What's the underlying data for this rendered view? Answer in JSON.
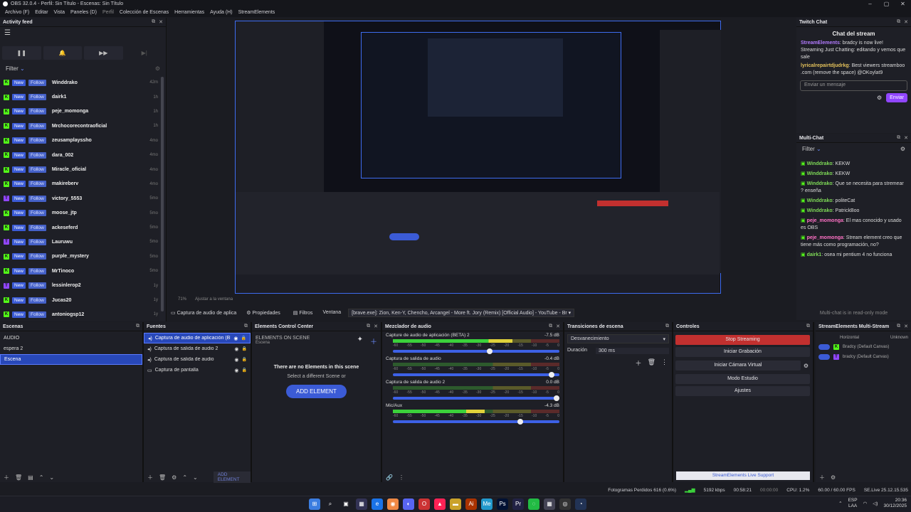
{
  "window": {
    "title": "OBS 32.0.4 - Perfil: Sin Título - Escenas: Sin Título",
    "controls": [
      "–",
      "▢",
      "✕"
    ]
  },
  "menu": [
    "Archivo (F)",
    "Editar",
    "Vista",
    "Paneles (D)",
    "Perfil",
    "Colección de Escenas",
    "Herramientas",
    "Ayuda (H)",
    "StreamElements"
  ],
  "activity": {
    "title": "Activity feed",
    "controls": [
      "❚❚",
      "🔔",
      "▶▶",
      "▶|"
    ],
    "filter": "Filter",
    "items": [
      {
        "platform": "kick",
        "name": "Winddrako",
        "time": "42m"
      },
      {
        "platform": "kick",
        "name": "dairk1",
        "time": "1h"
      },
      {
        "platform": "kick",
        "name": "peje_momonga",
        "time": "1h"
      },
      {
        "platform": "kick",
        "name": "Mrchocorecontraoficial",
        "time": "1h"
      },
      {
        "platform": "kick",
        "name": "zeusamplayssho",
        "time": "4mo"
      },
      {
        "platform": "kick",
        "name": "dara_002",
        "time": "4mo"
      },
      {
        "platform": "kick",
        "name": "Miracle_oficial",
        "time": "4mo"
      },
      {
        "platform": "kick",
        "name": "makireberv",
        "time": "4mo"
      },
      {
        "platform": "twitch",
        "name": "victory_5553",
        "time": "5mo"
      },
      {
        "platform": "kick",
        "name": "moose_jtp",
        "time": "5mo"
      },
      {
        "platform": "kick",
        "name": "ackeseferd",
        "time": "5mo"
      },
      {
        "platform": "twitch",
        "name": "Lauruwu",
        "time": "5mo"
      },
      {
        "platform": "kick",
        "name": "purple_mystery",
        "time": "5mo"
      },
      {
        "platform": "kick",
        "name": "MrTinoco",
        "time": "5mo"
      },
      {
        "platform": "twitch",
        "name": "lessinlerop2",
        "time": "1y"
      },
      {
        "platform": "kick",
        "name": "Jucas20",
        "time": "1y"
      },
      {
        "platform": "kick",
        "name": "antoniogsp12",
        "time": "1y"
      }
    ],
    "badge_new": "New",
    "badge_follow": "Follow"
  },
  "preview_bar": {
    "zoom": "71%",
    "fit": "Ajustar a la ventana"
  },
  "twitch": {
    "title": "Twitch Chat",
    "header": "Chat del stream",
    "messages": [
      {
        "user": "StreamElements",
        "text": ": bradcy is now live! Streaming Just Chatting: editando y vemos que sale"
      },
      {
        "user": "lyricalrepairtdjudrkg",
        "text": ": Best viewers streamboo .com (remove the space) @OKoylat9"
      }
    ],
    "input_placeholder": "Enviar un mensaje",
    "send": "Enviar"
  },
  "multichat": {
    "title": "Multi-Chat",
    "filter": "Filter",
    "messages": [
      {
        "user": "Winddrako",
        "text": ": KEKW",
        "c": "grn"
      },
      {
        "user": "Winddrako",
        "text": ": KEKW",
        "c": "grn"
      },
      {
        "user": "Winddrako",
        "text": ": Que se necesita para stremear ? enseña",
        "c": "grn"
      },
      {
        "user": "Winddrako",
        "text": ": politeCat",
        "c": "grn"
      },
      {
        "user": "Winddrako",
        "text": ": PatrickBoo",
        "c": "grn"
      },
      {
        "user": "peje_momonga",
        "text": ": El mas conocido y usado es OBS",
        "c": "pnk"
      },
      {
        "user": "peje_momonga",
        "text": ": Stream element creo que tiene más como programación, no?",
        "c": "pnk"
      },
      {
        "user": "dairk1",
        "text": ": osea mi pentium 4 no funciona",
        "c": "grn"
      }
    ],
    "readonly": "Multi-chat is in read-only mode"
  },
  "source_bar": {
    "source": "Captura de audio de aplica",
    "props": "Propiedades",
    "filters": "Filtros",
    "window_label": "Ventana",
    "window_value": "[brave.exe]: Zion, Ken-Y, Chencho, Arcangel - More ft. Jory (Remix) [Official Audio] - YouTube - Br"
  },
  "scenes": {
    "title": "Escenas",
    "items": [
      "AUDIO",
      "espera 2",
      "Escena"
    ],
    "selected": 2
  },
  "sources": {
    "title": "Fuentes",
    "items": [
      "Captura de audio de aplicación (BE",
      "Captura de salida de audio 2",
      "Captura de salida de audio",
      "Captura de pantalla"
    ],
    "add_element": "ADD ELEMENT"
  },
  "ecc": {
    "title": "Elements Control Center",
    "on_scene": "ELEMENTS ON SCENE",
    "scene": "Escena",
    "empty": "There are no Elements in this scene",
    "hint": "Select a different Scene or",
    "add": "ADD ELEMENT"
  },
  "mixer": {
    "title": "Mezclador de audio",
    "scale": [
      "-60",
      "-55",
      "-50",
      "-45",
      "-40",
      "-35",
      "-30",
      "-25",
      "-20",
      "-15",
      "-10",
      "-5",
      "0"
    ],
    "tracks": [
      {
        "name": "Capture de audio de aplicación (BETA) 2",
        "db": "-7.5 dB",
        "level": 0.72,
        "vol": 0.6
      },
      {
        "name": "Captura de salida de audio",
        "db": "-0.4 dB",
        "level": 0.0,
        "vol": 0.97
      },
      {
        "name": "Captura de salida de audio 2",
        "db": "0.0 dB",
        "level": 0.0,
        "vol": 1.0
      },
      {
        "name": "Mic/Aux",
        "db": "-4.3 dB",
        "level": 0.55,
        "vol": 0.78
      }
    ]
  },
  "transitions": {
    "title": "Transiciones de escena",
    "type": "Desvanecimiento",
    "duration_label": "Duración",
    "duration": "300 ms"
  },
  "controls": {
    "title": "Controles",
    "buttons": [
      "Stop Streaming",
      "Iniciar Grabación",
      "Iniciar Cámara Virtual",
      "Modo Estudio",
      "Ajustes"
    ],
    "support": "StreamElements Live Support"
  },
  "semulti": {
    "title": "StreamElements Multi-Stream",
    "horizontal": "Horizontal",
    "unknown": "Unknown",
    "row1": "Bradcy (Default Canvas)",
    "row2": "bradcy (Default Canvas)"
  },
  "status": {
    "frames": "Fotogramas Perdidos 616 (0.6%)",
    "kbps": "5192 kbps",
    "time1": "00:58:21",
    "time2": "00:00:00",
    "cpu": "CPU: 1.2%",
    "fps": "60.00 / 60.00 FPS",
    "se": "SE.Live 25.12.15.535"
  },
  "tray": {
    "lang1": "ESP",
    "lang2": "LAA",
    "time": "20:36",
    "date": "30/12/2025"
  },
  "colors": {
    "accent": "#3b5bd6",
    "stop": "#c2302f",
    "kick": "#53fc18",
    "twitch": "#9146ff"
  }
}
